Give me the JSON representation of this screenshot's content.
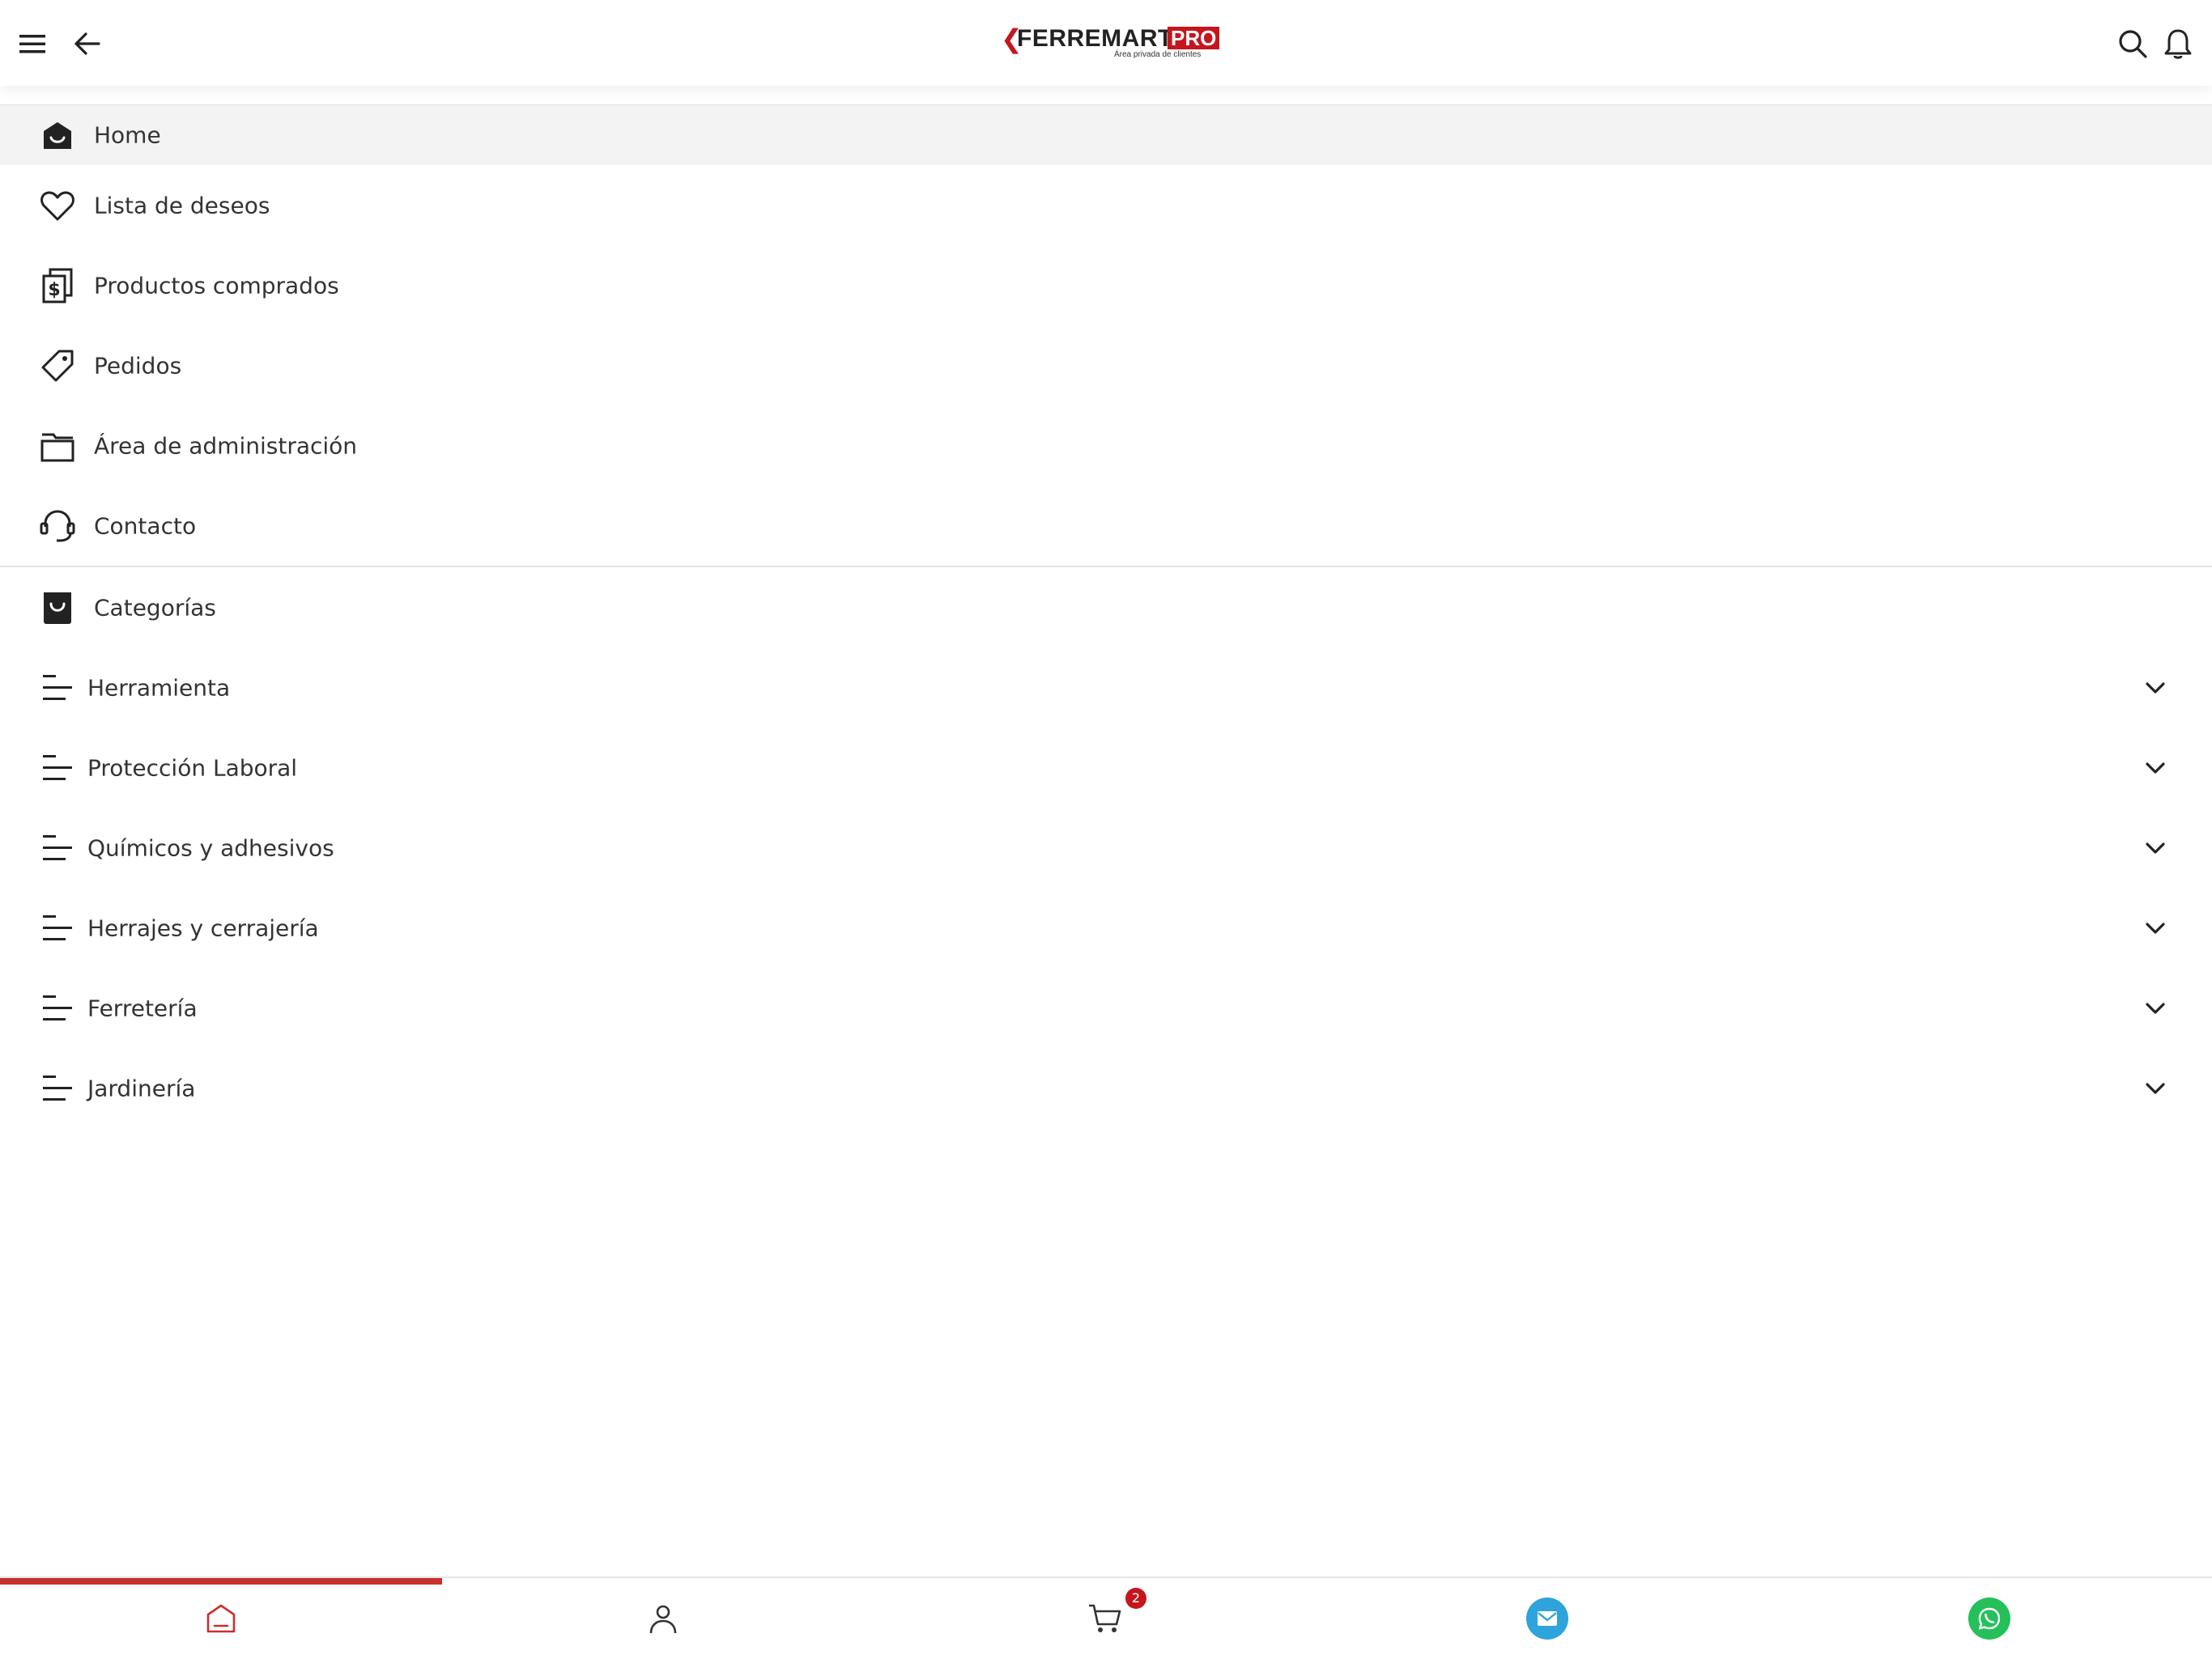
{
  "header": {
    "logo_arrow": "❮",
    "logo_word": "FERREMART",
    "logo_pro": "PRO",
    "logo_tagline": "Área privada de clientes",
    "icons": [
      "menu-icon",
      "back-arrow-icon",
      "search-icon",
      "bell-icon"
    ]
  },
  "menu": {
    "items": [
      {
        "label": "Home",
        "icon": "home-icon",
        "active": true
      },
      {
        "label": "Lista de deseos",
        "icon": "heart-icon"
      },
      {
        "label": "Productos comprados",
        "icon": "receipt-icon"
      },
      {
        "label": "Pedidos",
        "icon": "tag-icon"
      },
      {
        "label": "Área de administración",
        "icon": "folder-icon"
      },
      {
        "label": "Contacto",
        "icon": "headset-icon"
      }
    ],
    "categories_label": "Categorías",
    "categories": [
      {
        "label": "Herramienta"
      },
      {
        "label": "Protección Laboral"
      },
      {
        "label": "Químicos y adhesivos"
      },
      {
        "label": "Herrajes y cerrajería"
      },
      {
        "label": "Ferretería"
      },
      {
        "label": "Jardinería"
      }
    ]
  },
  "bottom_nav": {
    "cart_badge": "2",
    "items": [
      "home-icon",
      "user-icon",
      "cart-icon",
      "mail-icon",
      "whatsapp-icon"
    ]
  },
  "colors": {
    "brand_red": "#c4161c",
    "active_bar": "#c8302d",
    "mail_blue": "#2ea3dc",
    "whatsapp_green": "#25c05a"
  }
}
